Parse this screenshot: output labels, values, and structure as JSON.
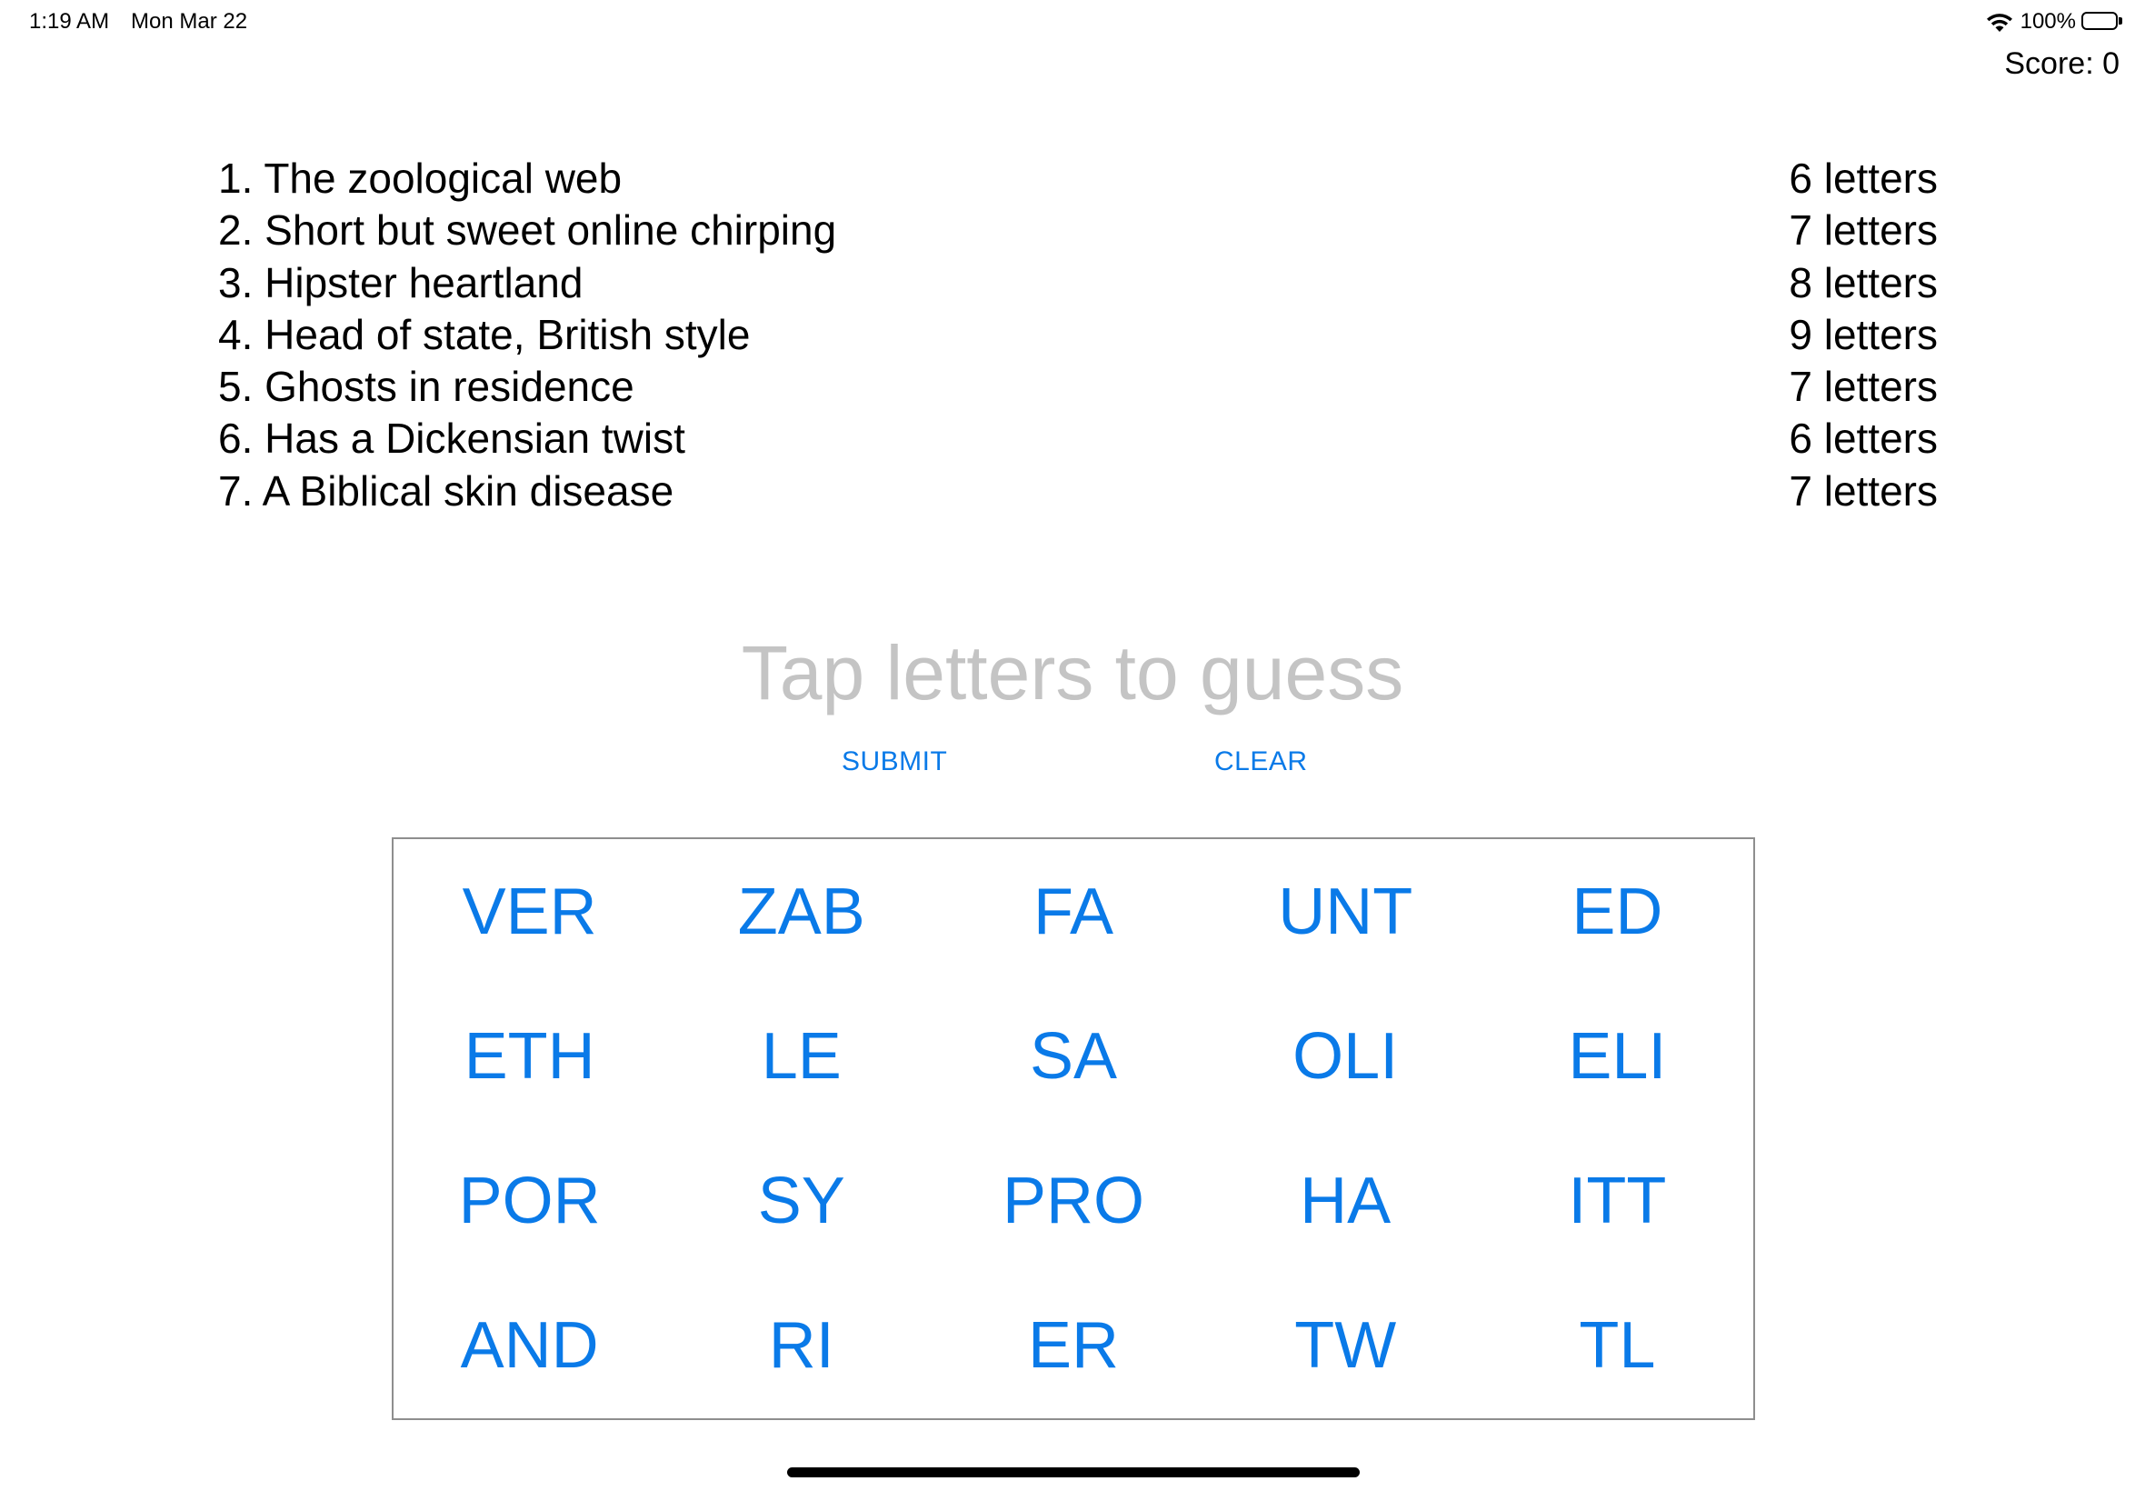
{
  "status_bar": {
    "time": "1:19 AM",
    "date": "Mon Mar 22",
    "battery_text": "100%",
    "battery_level": 1.0,
    "icons": [
      "wifi-icon",
      "battery-icon"
    ]
  },
  "score": "Score: 0",
  "clues": [
    {
      "text": "1. The zoological web",
      "length": "6 letters"
    },
    {
      "text": "2. Short but sweet online chirping",
      "length": "7 letters"
    },
    {
      "text": "3. Hipster heartland",
      "length": "8 letters"
    },
    {
      "text": "4. Head of state, British style",
      "length": "9 letters"
    },
    {
      "text": "5. Ghosts in residence",
      "length": "7 letters"
    },
    {
      "text": "6. Has a Dickensian twist",
      "length": "6 letters"
    },
    {
      "text": "7. A Biblical skin disease",
      "length": "7 letters"
    }
  ],
  "guess": {
    "placeholder": "Tap letters to guess"
  },
  "actions": {
    "submit_label": "SUBMIT",
    "clear_label": "CLEAR"
  },
  "tiles": [
    "VER",
    "ZAB",
    "FA",
    "UNT",
    "ED",
    "ETH",
    "LE",
    "SA",
    "OLI",
    "ELI",
    "POR",
    "SY",
    "PRO",
    "HA",
    "ITT",
    "AND",
    "RI",
    "ER",
    "TW",
    "TL"
  ],
  "colors": {
    "accent": "#0A7AE8",
    "placeholder": "#C4C4C4",
    "grid_border": "#8E8E8E",
    "text": "#000000",
    "background": "#FFFFFF"
  }
}
